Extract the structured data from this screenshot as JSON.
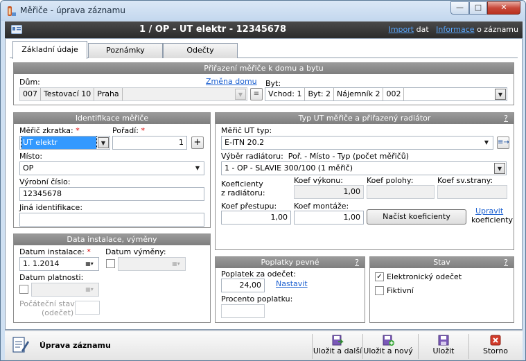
{
  "window": {
    "title": "Měřiče - úprava záznamu"
  },
  "header": {
    "record_title": "1 / OP - UT elektr - 12345678",
    "import_link": "Import",
    "import_suffix": "dat",
    "info_link": "Informace",
    "info_suffix": "o záznamu"
  },
  "tabs": [
    "Základní údaje",
    "Poznámky",
    "Odečty"
  ],
  "assign": {
    "title": "Přiřazení měřiče k domu a bytu",
    "dum_label": "Dům:",
    "change_link": "Změna domu",
    "dum_values": [
      "007",
      "Testovací 10",
      "Praha"
    ],
    "byt_label": "Byt:",
    "byt_values": [
      "Vchod: 1",
      "Byt: 2",
      "Nájemník 2",
      "002"
    ]
  },
  "ident": {
    "title": "Identifikace měřiče",
    "zkratka_label": "Měřič zkratka:",
    "zkratka_value": "UT elektr",
    "poradi_label": "Pořadí:",
    "poradi_value": "1",
    "misto_label": "Místo:",
    "misto_value": "OP",
    "vyrobni_label": "Výrobní číslo:",
    "vyrobni_value": "12345678",
    "jina_label": "Jiná identifikace:",
    "jina_value": ""
  },
  "typ": {
    "title": "Typ UT měřiče a přiřazený radiátor",
    "help": "?",
    "typ_label": "Měřič UT typ:",
    "typ_value": "E-ITN 20.2",
    "radiator_label": "Výběr radiátoru:",
    "radiator_hint": "Poř. - Místo - Typ (počet měřičů)",
    "radiator_value": "1 - OP - SLAVIE 300/100 (1 měřič)",
    "koef_rad_label_1": "Koeficienty",
    "koef_rad_label_2": "z radiátoru:",
    "koef_vykonu_label": "Koef výkonu:",
    "koef_vykonu_value": "1,00",
    "koef_polohy_label": "Koef polohy:",
    "koef_polohy_value": "",
    "koef_strany_label": "Koef sv.strany:",
    "koef_strany_value": "",
    "koef_prestupu_label": "Koef přestupu:",
    "koef_prestupu_value": "1,00",
    "koef_montaze_label": "Koef montáže:",
    "koef_montaze_value": "1,00",
    "nacist_button": "Načíst koeficienty",
    "upravit_link": "Upravit",
    "upravit_suffix": "koeficienty"
  },
  "install": {
    "title": "Data instalace, výměny",
    "datum_instalace_label": "Datum instalace:",
    "datum_instalace_value": "1.  1.2014",
    "datum_vymeny_label": "Datum výměny:",
    "datum_platnosti_label": "Datum platnosti:",
    "pocatecni_label_1": "Počáteční stav:",
    "pocatecni_label_2": "(odečet)"
  },
  "poplatky": {
    "title": "Poplatky pevné",
    "help": "?",
    "za_odecet_label": "Poplatek za odečet:",
    "za_odecet_value": "24,00",
    "nastavit_link": "Nastavit",
    "procento_label": "Procento poplatku:"
  },
  "stav": {
    "title": "Stav",
    "help": "?",
    "elektronicky_label": "Elektronický odečet",
    "elektronicky_checked": true,
    "fiktivni_label": "Fiktivní",
    "fiktivni_checked": false
  },
  "footer": {
    "mode": "Úprava záznamu",
    "buttons": [
      "Uložit a další",
      "Uložit a nový",
      "Uložit",
      "Storno"
    ]
  }
}
